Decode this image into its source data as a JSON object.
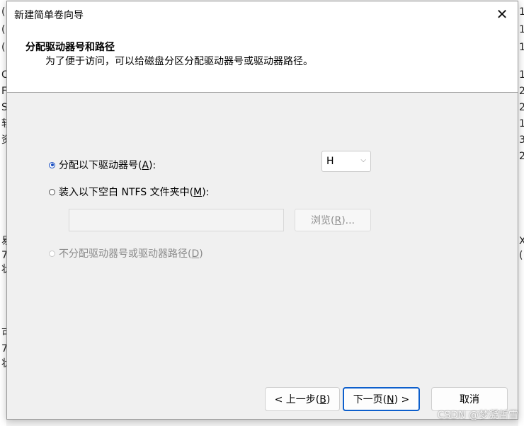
{
  "background": {
    "left_chars": [
      "(",
      "(",
      "(",
      "C",
      "F",
      "S",
      "软",
      "资",
      "",
      "",
      "",
      "易",
      "7",
      "状",
      "",
      "",
      "",
      "可",
      "7",
      "状"
    ],
    "right_chars": [
      "1",
      "1",
      "1",
      "1",
      "2",
      "2",
      "1",
      "3",
      "2",
      "",
      "",
      "X",
      "(",
      "",
      "",
      "",
      "",
      "",
      "",
      ""
    ]
  },
  "dialog": {
    "title": "新建简单卷向导",
    "close_glyph": "✕",
    "header_title": "分配驱动器号和路径",
    "header_subtitle": "为了便于访问，可以给磁盘分区分配驱动器号或驱动器路径。"
  },
  "options": {
    "assign_letter": {
      "text": "分配以下驱动器号(",
      "key": "A",
      "suffix": "):",
      "selected": true
    },
    "mount_folder": {
      "text": "装入以下空白 NTFS 文件夹中(",
      "key": "M",
      "suffix": "):",
      "selected": false
    },
    "no_assign": {
      "text": "不分配驱动器号或驱动器路径(",
      "key": "D",
      "suffix": ")",
      "selected": false,
      "disabled": true
    }
  },
  "drive_letter": {
    "value": "H",
    "chevron": "⌵"
  },
  "folder_path": {
    "value": "",
    "placeholder": ""
  },
  "browse": {
    "text": "浏览(",
    "key": "R",
    "suffix": ")..."
  },
  "buttons": {
    "back": {
      "text": "< 上一步(",
      "key": "B",
      "suffix": ")"
    },
    "next": {
      "text": "下一页(",
      "key": "N",
      "suffix": ") >"
    },
    "cancel": {
      "text": "取消"
    }
  },
  "watermark": "CSDN @梦凝哲雪",
  "colors": {
    "accent": "#0d5fcc",
    "radio_selected": "#1a4fc2"
  }
}
